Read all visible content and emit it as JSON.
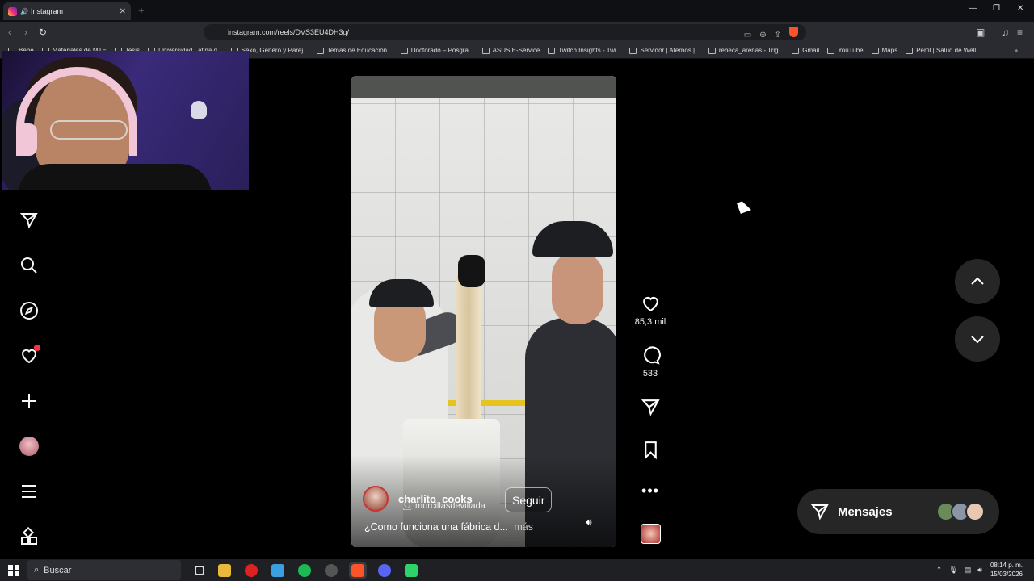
{
  "browser": {
    "tab": {
      "title": "Instagram"
    },
    "url": "instagram.com/reels/DVS3EU4DH3g/",
    "bookmarks": [
      "Bebe",
      "Materiales de MTE",
      "Tesis",
      "Universidad Latina d...",
      "Sexo, Género y Parej...",
      "Temas de Educación...",
      "Doctorado – Posgra...",
      "ASUS E-Service",
      "Twitch Insights - Twi...",
      "Servidor | Aternos |...",
      "rebeca_arenas - Trig...",
      "Gmail",
      "YouTube",
      "Maps",
      "Perfil | Salud de Well..."
    ]
  },
  "sidebar": {
    "items": [
      "messages-icon",
      "search-icon",
      "explore-icon",
      "notifications-icon",
      "create-icon",
      "profile-avatar",
      "menu-icon",
      "apps-icon"
    ]
  },
  "reel": {
    "username": "charlito_cooks",
    "audio": "morcillasdevillada",
    "follow_label": "Seguir",
    "caption": "¿Como funciona una fábrica d...",
    "more_label": "más"
  },
  "actions": {
    "likes": "85,3 mil",
    "comments": "533"
  },
  "messages": {
    "label": "Mensajes"
  },
  "taskbar": {
    "search_placeholder": "Buscar",
    "time": "08:14 p. m.",
    "date": "15/03/2026"
  },
  "colors": {
    "notification_dot": "#ff3040",
    "brave": "#fb542b",
    "panel": "#262626"
  }
}
